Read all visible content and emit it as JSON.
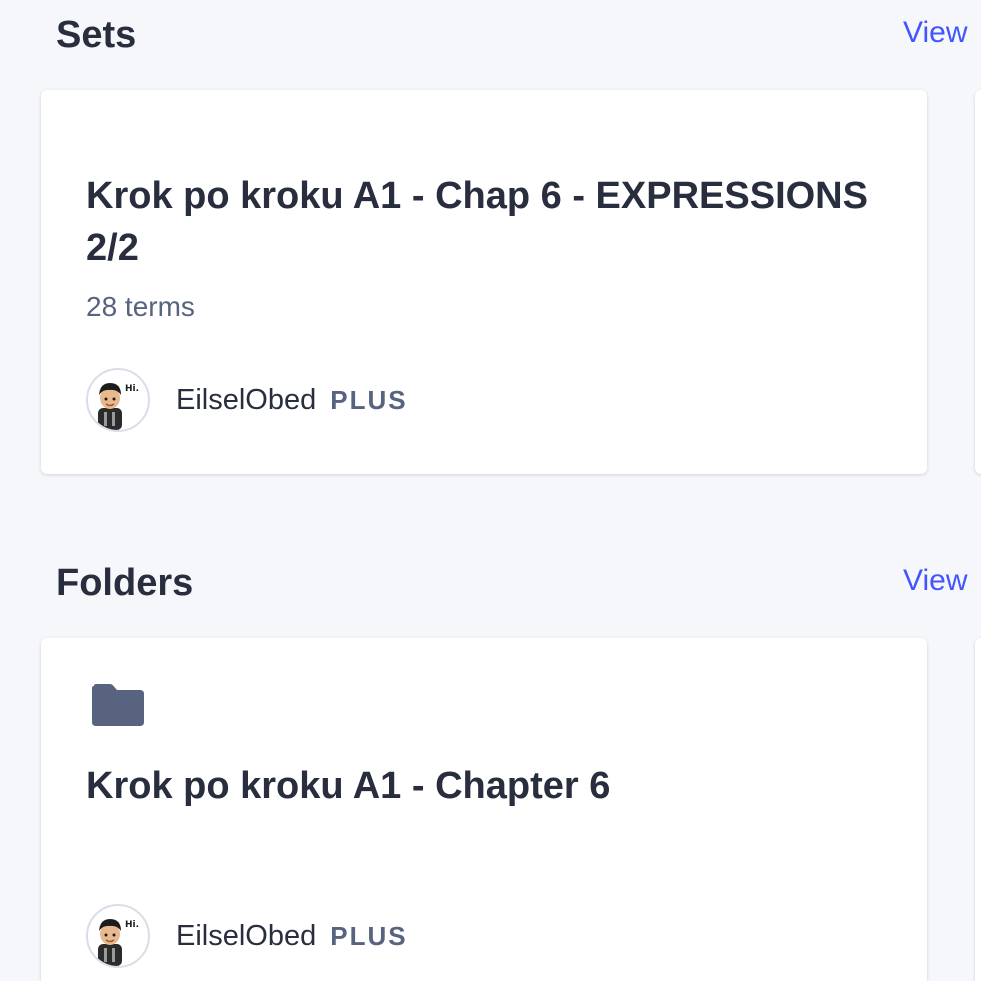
{
  "sets": {
    "title": "Sets",
    "view_all_label": "View",
    "card": {
      "title": "Krok po kroku A1 - Chap 6 - EXPRESSIONS 2/2",
      "term_count": "28 terms",
      "author": {
        "name": "EilselObed",
        "badge": "PLUS",
        "avatar_text": "Hi."
      }
    }
  },
  "folders": {
    "title": "Folders",
    "view_all_label": "View",
    "card": {
      "icon": "folder-icon",
      "title": "Krok po kroku A1 - Chapter 6",
      "author": {
        "name": "EilselObed",
        "badge": "PLUS",
        "avatar_text": "Hi."
      }
    }
  },
  "colors": {
    "background": "#f6f7fb",
    "card": "#ffffff",
    "heading": "#282e3e",
    "secondary_text": "#586380",
    "link": "#4255ff",
    "folder_icon": "#586380"
  }
}
